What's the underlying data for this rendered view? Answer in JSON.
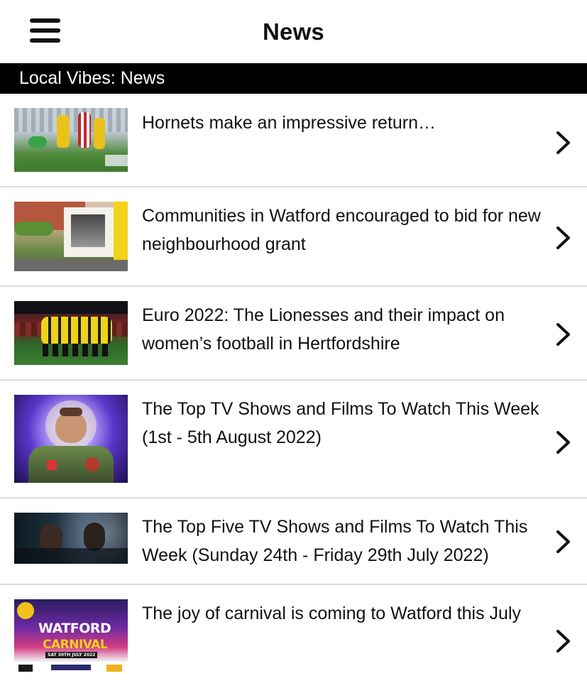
{
  "header": {
    "title": "News",
    "menu_icon": "hamburger-menu-icon"
  },
  "section": {
    "label": "Local Vibes: News"
  },
  "news": [
    {
      "headline": "Hornets make an impressive return…",
      "thumbnail": "football-match-thumbnail"
    },
    {
      "headline": "Communities in Watford encouraged to bid for new neighbourhood grant",
      "thumbnail": "watford-street-mural-thumbnail"
    },
    {
      "headline": "Euro 2022: The Lionesses and their impact on women’s football in Hertfordshire",
      "thumbnail": "team-huddle-thumbnail"
    },
    {
      "headline": "The Top TV Shows and Films To Watch This Week (1st - 5th August 2022)",
      "thumbnail": "animated-astronaut-thumbnail"
    },
    {
      "headline": "The Top Five TV Shows and Films To Watch This Week (Sunday 24th - Friday 29th July 2022)",
      "thumbnail": "tv-show-still-thumbnail"
    },
    {
      "headline": "The joy of carnival is coming to Watford this July",
      "thumbnail": "watford-carnival-poster-thumbnail",
      "poster_text": {
        "title": "WATFORD",
        "subtitle": "CARNIVAL",
        "date": "SAT 30TH JULY 2022"
      }
    }
  ],
  "icons": {
    "row_chevron": "chevron-right-icon"
  }
}
